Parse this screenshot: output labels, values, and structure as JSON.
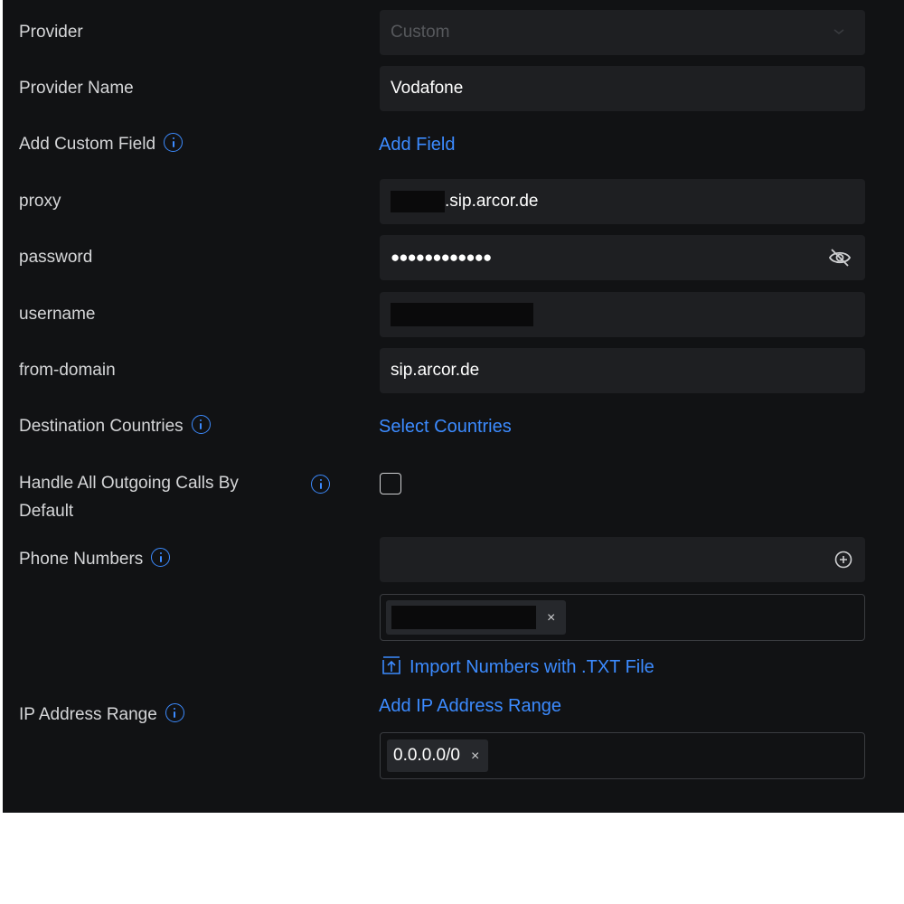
{
  "form": {
    "provider": {
      "label": "Provider",
      "value": "Custom"
    },
    "provider_name": {
      "label": "Provider Name",
      "value": "Vodafone"
    },
    "custom_field": {
      "label": "Add Custom Field",
      "link": "Add Field"
    },
    "proxy": {
      "label": "proxy",
      "value_suffix": ".sip.arcor.de"
    },
    "password": {
      "label": "password",
      "value": "●●●●●●●●●●●●"
    },
    "username": {
      "label": "username"
    },
    "from_domain": {
      "label": "from-domain",
      "value": "sip.arcor.de"
    },
    "destination_countries": {
      "label": "Destination Countries",
      "link": "Select Countries"
    },
    "outgoing_default": {
      "label_line1": "Handle All Outgoing Calls By",
      "label_line2": "Default",
      "checked": false
    },
    "phone_numbers": {
      "label": "Phone Numbers",
      "chip_remove": "×",
      "import_link": "Import Numbers with .TXT File"
    },
    "ip_range": {
      "label": "IP Address Range",
      "link": "Add IP Address Range",
      "chip_value": "0.0.0.0/0",
      "chip_remove": "×"
    }
  },
  "colors": {
    "panel_bg": "#111214",
    "field_bg": "#1e1f22",
    "accent": "#3c8bff",
    "label": "#d5d6d8"
  },
  "icons": [
    "info-icon",
    "chevron-down-icon",
    "eye-off-icon",
    "plus-circle-icon",
    "upload-icon",
    "close-icon"
  ]
}
